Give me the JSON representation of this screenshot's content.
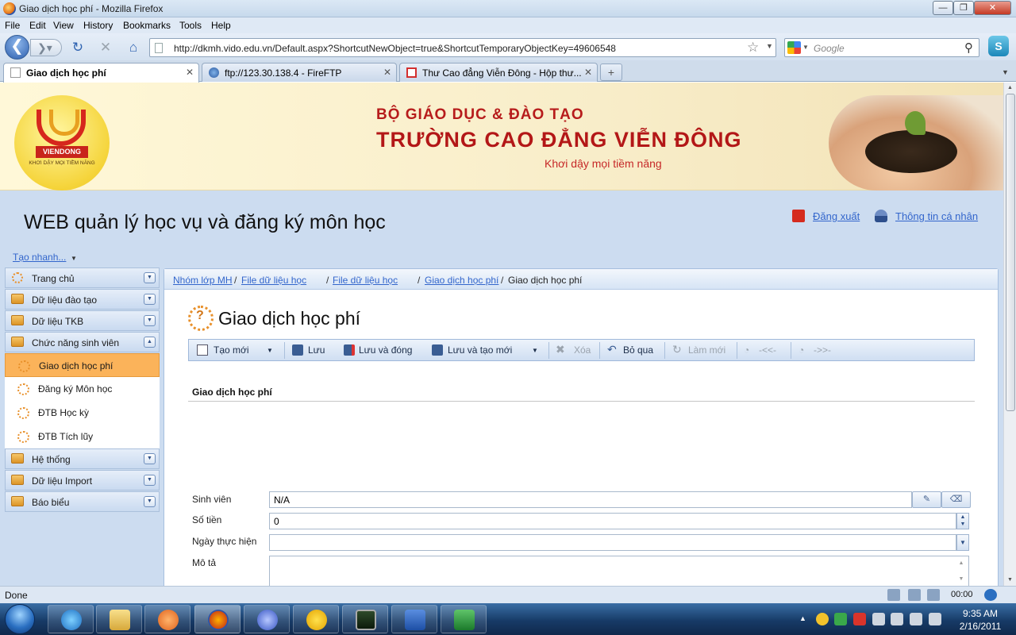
{
  "window": {
    "title": "Giao dịch học phí - Mozilla Firefox",
    "controls": {
      "minimize": "—",
      "maximize": "❐",
      "close": "✕"
    }
  },
  "menu": [
    "File",
    "Edit",
    "View",
    "History",
    "Bookmarks",
    "Tools",
    "Help"
  ],
  "nav": {
    "url": "http://dkmh.vido.edu.vn/Default.aspx?ShortcutNewObject=true&ShortcutTemporaryObjectKey=49606548",
    "search_placeholder": "Google"
  },
  "tabs": [
    {
      "label": "Giao dịch học phí",
      "active": true
    },
    {
      "label": "ftp://123.30.138.4 - FireFTP",
      "active": false
    },
    {
      "label": "Thư Cao đẳng Viễn Đông - Hộp thư...",
      "active": false
    }
  ],
  "banner": {
    "logo_name": "VIENDONG",
    "logo_slogan": "KHƠI DẬY MỌI TIỀM NĂNG",
    "line1": "BỘ GIÁO DỤC & ĐÀO TẠO",
    "line2": "TRƯỜNG CAO ĐẲNG VIỄN ĐÔNG",
    "line3": "Khơi dậy mọi tiềm năng"
  },
  "header": {
    "app_title": "WEB quản lý học vụ và đăng ký môn học",
    "logout": "Đăng xuất",
    "profile": "Thông tin cá nhân",
    "quick_create": "Tạo nhanh..."
  },
  "sidebar": {
    "groups": [
      {
        "label": "Trang chủ",
        "expanded": false
      },
      {
        "label": "Dữ liệu đào tạo",
        "expanded": false
      },
      {
        "label": "Dữ liệu TKB",
        "expanded": false
      },
      {
        "label": "Chức năng sinh viên",
        "expanded": true,
        "items": [
          "Giao dịch học phí",
          "Đăng ký Môn học",
          "ĐTB Học kỳ",
          "ĐTB Tích lũy"
        ]
      },
      {
        "label": "Hệ thống",
        "expanded": false
      },
      {
        "label": "Dữ liệu Import",
        "expanded": false
      },
      {
        "label": "Báo biểu",
        "expanded": false
      }
    ],
    "active_item": "Giao dịch học phí"
  },
  "breadcrumb": {
    "links": [
      "Nhóm lớp MH",
      "File dữ liệu học",
      "File dữ liệu học",
      "Giao dịch học phí"
    ],
    "separator": "/",
    "current": "Giao dịch học phí"
  },
  "page": {
    "title": "Giao dịch học phí",
    "toolbar": {
      "new": "Tạo mới",
      "save": "Lưu",
      "save_close": "Lưu và đóng",
      "save_new": "Lưu và tạo mới",
      "delete": "Xóa",
      "cancel": "Bỏ qua",
      "refresh": "Làm mới",
      "prev": "-<<-",
      "next": "->>-"
    },
    "form": {
      "section_title": "Giao dịch học phí",
      "student_label": "Sinh viên",
      "student_value": "N/A",
      "amount_label": "Số tiền",
      "amount_value": "0",
      "date_label": "Ngày thực hiện",
      "date_value": "",
      "desc_label": "Mô tả",
      "desc_value": ""
    }
  },
  "status": {
    "text": "Done",
    "time": "00:00"
  },
  "taskbar": {
    "time": "9:35 AM",
    "date": "2/16/2011"
  },
  "colors": {
    "accent": "#fbb35a",
    "link": "#3366cc",
    "banner_red": "#b31717",
    "panel_blue": "#ccdcf0"
  }
}
